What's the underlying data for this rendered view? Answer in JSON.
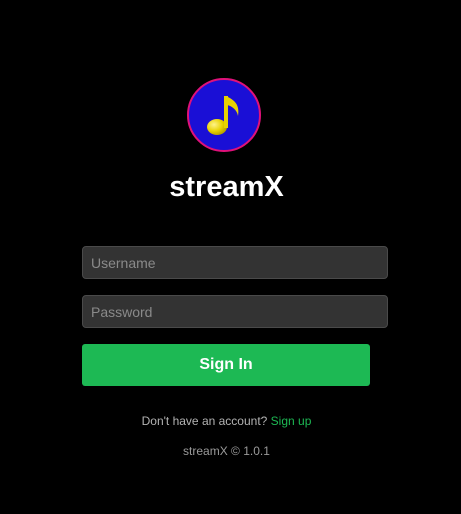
{
  "app": {
    "title": "streamX",
    "logo_icon": "music-note-icon"
  },
  "form": {
    "username_placeholder": "Username",
    "password_placeholder": "Password",
    "signin_label": "Sign In"
  },
  "footer": {
    "account_prompt": "Don't have an account?",
    "signup_label": "Sign up",
    "version_text": "streamX © 1.0.1"
  },
  "colors": {
    "background": "#000000",
    "accent": "#1db954",
    "logo_fill": "#1a0fd6",
    "logo_border": "#e0117a",
    "note_color": "#e8d200",
    "input_bg": "#333333"
  }
}
